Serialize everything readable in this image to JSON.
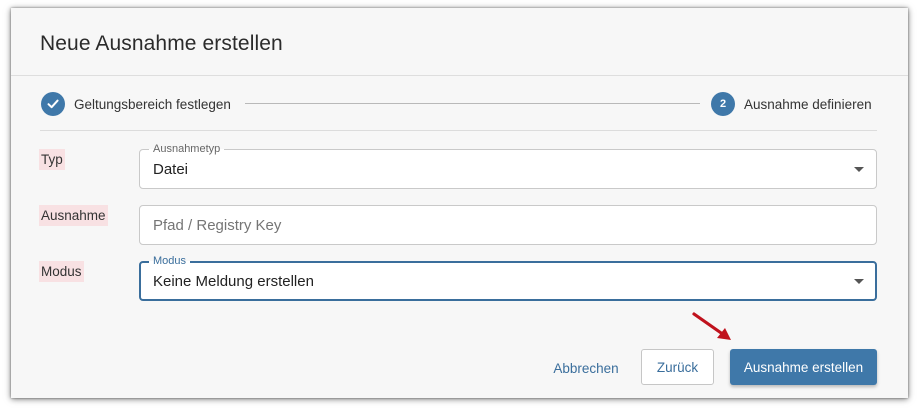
{
  "dialog": {
    "title": "Neue Ausnahme erstellen"
  },
  "stepper": {
    "steps": [
      {
        "label": "Geltungsbereich festlegen",
        "state": "completed",
        "icon": "check-icon"
      },
      {
        "number": "2",
        "label": "Ausnahme definieren",
        "state": "active"
      }
    ]
  },
  "form": {
    "typ": {
      "label": "Typ",
      "legend": "Ausnahmetyp",
      "value": "Datei"
    },
    "ausnahme": {
      "label": "Ausnahme",
      "placeholder": "Pfad / Registry Key"
    },
    "modus": {
      "label": "Modus",
      "legend": "Modus",
      "value": "Keine Meldung erstellen"
    }
  },
  "actions": {
    "cancel_label": "Abbrechen",
    "back_label": "Zurück",
    "create_label": "Ausnahme erstellen"
  },
  "colors": {
    "accent": "#3f78a9",
    "annotation_arrow": "#c0121d",
    "label_highlight": "#f8e1e3"
  }
}
